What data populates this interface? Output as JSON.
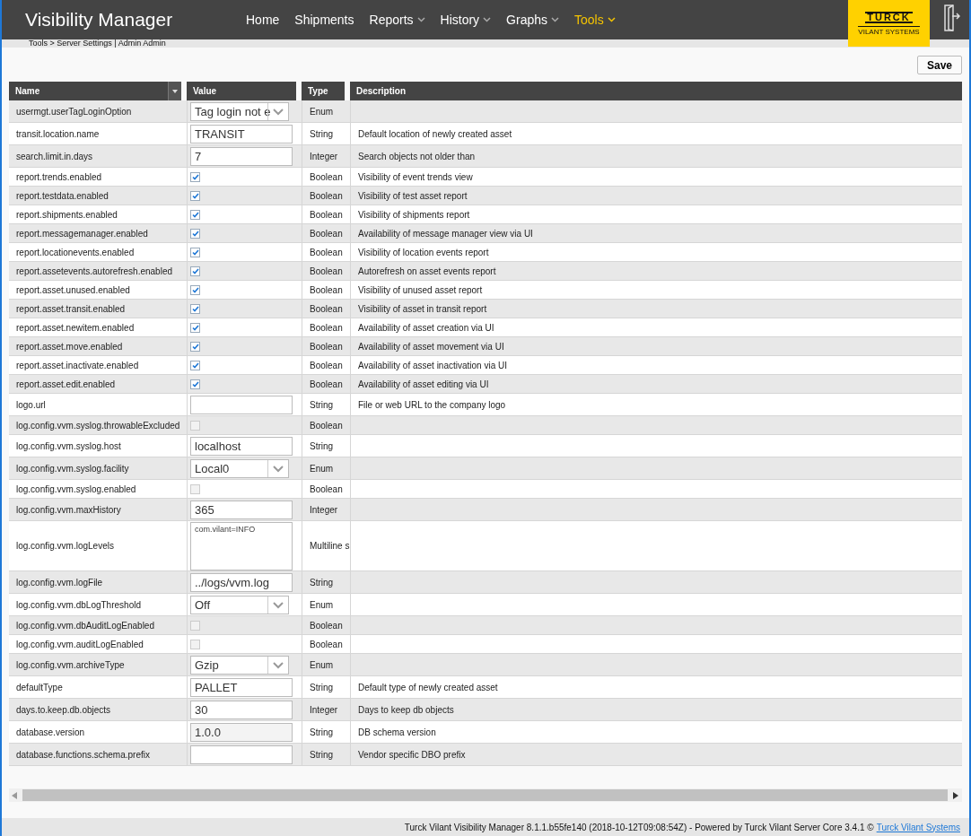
{
  "header": {
    "title": "Visibility Manager",
    "nav": [
      {
        "label": "Home",
        "dropdown": false,
        "selected": false
      },
      {
        "label": "Shipments",
        "dropdown": false,
        "selected": false
      },
      {
        "label": "Reports",
        "dropdown": true,
        "selected": false
      },
      {
        "label": "History",
        "dropdown": true,
        "selected": false
      },
      {
        "label": "Graphs",
        "dropdown": true,
        "selected": false
      },
      {
        "label": "Tools",
        "dropdown": true,
        "selected": true
      }
    ],
    "logo": {
      "name": "TURCK",
      "subtitle": "VILANT SYSTEMS"
    }
  },
  "breadcrumb": "Tools > Server Settings | Admin Admin",
  "save_button": "Save",
  "table": {
    "columns": [
      "Name",
      "Value",
      "Type",
      "Description"
    ],
    "rows": [
      {
        "name": "usermgt.userTagLoginOption",
        "kind": "select",
        "value": "Tag login not e",
        "type": "Enum"
      },
      {
        "name": "transit.location.name",
        "kind": "text",
        "value": "TRANSIT",
        "type": "String",
        "description": "Default location of newly created asset"
      },
      {
        "name": "search.limit.in.days",
        "kind": "text",
        "value": "7",
        "type": "Integer",
        "description": "Search objects not older than"
      },
      {
        "name": "report.trends.enabled",
        "kind": "checkbox",
        "checked": true,
        "type": "Boolean",
        "description": "Visibility of event trends view"
      },
      {
        "name": "report.testdata.enabled",
        "kind": "checkbox",
        "checked": true,
        "type": "Boolean",
        "description": "Visibility of test asset report"
      },
      {
        "name": "report.shipments.enabled",
        "kind": "checkbox",
        "checked": true,
        "type": "Boolean",
        "description": "Visibility of shipments report"
      },
      {
        "name": "report.messagemanager.enabled",
        "kind": "checkbox",
        "checked": true,
        "type": "Boolean",
        "description": "Availability of message manager view via UI"
      },
      {
        "name": "report.locationevents.enabled",
        "kind": "checkbox",
        "checked": true,
        "type": "Boolean",
        "description": "Visibility of location events report"
      },
      {
        "name": "report.assetevents.autorefresh.enabled",
        "kind": "checkbox",
        "checked": true,
        "type": "Boolean",
        "description": "Autorefresh on asset events report"
      },
      {
        "name": "report.asset.unused.enabled",
        "kind": "checkbox",
        "checked": true,
        "type": "Boolean",
        "description": "Visibility of unused asset report"
      },
      {
        "name": "report.asset.transit.enabled",
        "kind": "checkbox",
        "checked": true,
        "type": "Boolean",
        "description": "Visibility of asset in transit report"
      },
      {
        "name": "report.asset.newitem.enabled",
        "kind": "checkbox",
        "checked": true,
        "type": "Boolean",
        "description": "Availability of asset creation via UI"
      },
      {
        "name": "report.asset.move.enabled",
        "kind": "checkbox",
        "checked": true,
        "type": "Boolean",
        "description": "Availability of asset movement via UI"
      },
      {
        "name": "report.asset.inactivate.enabled",
        "kind": "checkbox",
        "checked": true,
        "type": "Boolean",
        "description": "Availability of asset inactivation via UI"
      },
      {
        "name": "report.asset.edit.enabled",
        "kind": "checkbox",
        "checked": true,
        "type": "Boolean",
        "description": "Availability of asset editing via UI"
      },
      {
        "name": "logo.url",
        "kind": "text",
        "type": "String",
        "description": "File or web URL to the company logo"
      },
      {
        "name": "log.config.vvm.syslog.throwableExcluded",
        "kind": "checkbox",
        "checked": false,
        "type": "Boolean"
      },
      {
        "name": "log.config.vvm.syslog.host",
        "kind": "text",
        "value": "localhost",
        "type": "String"
      },
      {
        "name": "log.config.vvm.syslog.facility",
        "kind": "select",
        "value": "Local0",
        "type": "Enum"
      },
      {
        "name": "log.config.vvm.syslog.enabled",
        "kind": "checkbox",
        "checked": false,
        "type": "Boolean"
      },
      {
        "name": "log.config.vvm.maxHistory",
        "kind": "text",
        "value": "365",
        "type": "Integer"
      },
      {
        "name": "log.config.vvm.logLevels",
        "kind": "textarea",
        "value": "com.vilant=INFO",
        "type": "Multiline s"
      },
      {
        "name": "log.config.vvm.logFile",
        "kind": "text",
        "value": "../logs/vvm.log",
        "type": "String"
      },
      {
        "name": "log.config.vvm.dbLogThreshold",
        "kind": "select",
        "value": "Off",
        "type": "Enum"
      },
      {
        "name": "log.config.vvm.dbAuditLogEnabled",
        "kind": "checkbox",
        "checked": false,
        "type": "Boolean"
      },
      {
        "name": "log.config.vvm.auditLogEnabled",
        "kind": "checkbox",
        "checked": false,
        "type": "Boolean"
      },
      {
        "name": "log.config.vvm.archiveType",
        "kind": "select",
        "value": "Gzip",
        "type": "Enum"
      },
      {
        "name": "defaultType",
        "kind": "text",
        "value": "PALLET",
        "type": "String",
        "description": "Default type of newly created asset"
      },
      {
        "name": "days.to.keep.db.objects",
        "kind": "text",
        "value": "30",
        "type": "Integer",
        "description": "Days to keep db objects"
      },
      {
        "name": "database.version",
        "kind": "text",
        "value": "1.0.0",
        "disabled": true,
        "type": "String",
        "description": "DB schema version"
      },
      {
        "name": "database.functions.schema.prefix",
        "kind": "text",
        "type": "String",
        "description": "Vendor specific DBO prefix"
      }
    ]
  },
  "footer": {
    "text": "Turck Vilant Visibility Manager 8.1.1.b55fe140 (2018-10-12T09:08:54Z) - Powered by Turck Vilant Server Core 3.4.1 ©",
    "link": "Turck Vilant Systems"
  }
}
